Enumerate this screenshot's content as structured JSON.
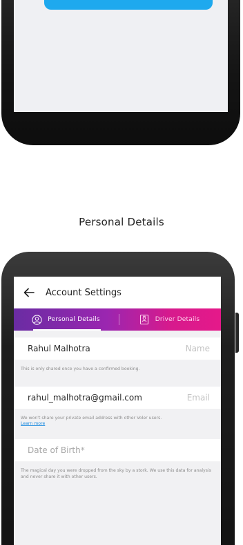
{
  "caption": "Personal Details",
  "appbar": {
    "title": "Account Settings",
    "back_icon": "arrow-left-icon"
  },
  "tabs": [
    {
      "label": "Personal Details",
      "icon": "user-circle-icon",
      "active": true
    },
    {
      "label": "Driver Details",
      "icon": "id-card-icon",
      "active": false
    }
  ],
  "fields": {
    "name": {
      "value": "Rahul Malhotra",
      "label": "Name",
      "helper": "This is only shared once you have a confirmed booking."
    },
    "email": {
      "value": "rahul_malhotra@gmail.com",
      "label": "Email",
      "helper": "We won't share your private email address with other Voler users.",
      "link": "Learn more"
    },
    "dob": {
      "placeholder": "Date of Birth*",
      "helper": "The magical day you were dropped from the sky by a stork. We use this data for analysis and never share it with other users."
    }
  },
  "colors": {
    "tab_gradient_start": "#6a2ca3",
    "tab_gradient_end": "#e5198a",
    "cta_blue": "#1ea9ee",
    "link_blue": "#1e8ce0",
    "screen_bg": "#f1f1f3"
  }
}
